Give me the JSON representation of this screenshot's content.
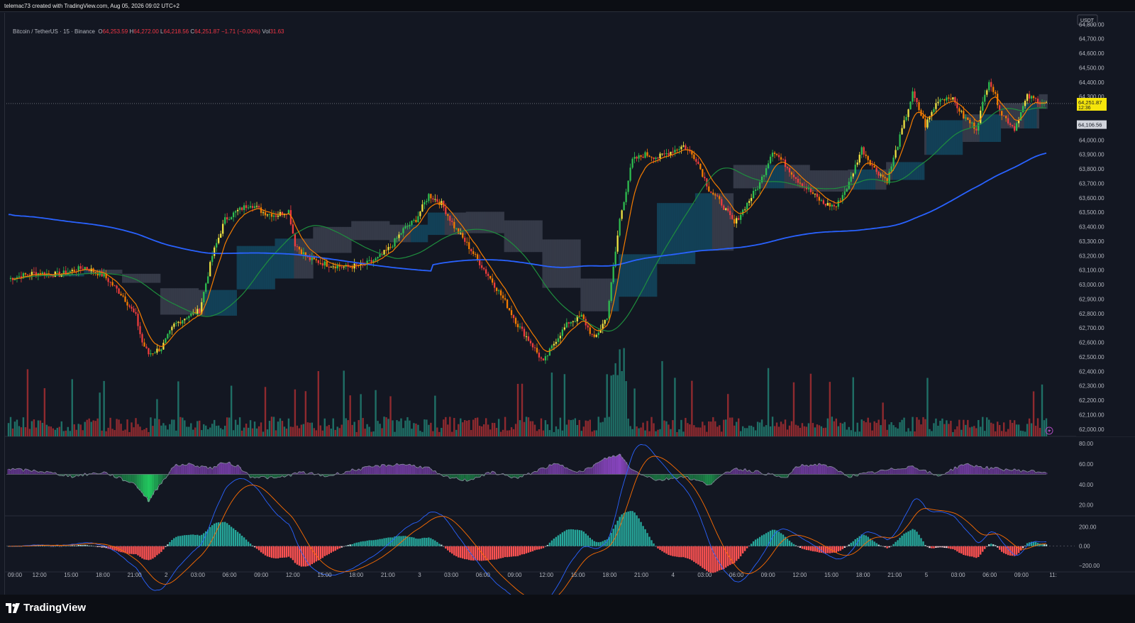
{
  "header": {
    "credit": "telemac73 created with TradingView.com, Aug 05, 2026 09:02 UTC+2"
  },
  "legend": {
    "symbol": "Bitcoin / TetherUS · 15 · Binance",
    "open_label": "O",
    "open": "64,253.59",
    "high_label": "H",
    "high": "64,272.00",
    "low_label": "L",
    "low": "64,218.56",
    "close_label": "C",
    "close": "64,251.87",
    "change": "−1.71 (−0.00%)",
    "vol_label": "Vol",
    "vol": "31.63"
  },
  "footer": {
    "brand": "TradingView"
  },
  "colors": {
    "background": "#131722",
    "grid": "#2a2e39",
    "up": "#2ebd4f",
    "down": "#ef3d3d",
    "vol_up": "#1f6f66",
    "vol_down": "#8f2a2f",
    "ma_blue": "#2962ff",
    "ma_green": "#1e8e3e",
    "ema_orange": "#f57c00",
    "cloud_teal": "#13475e",
    "cloud_grey": "#3b3f4d",
    "rsi_purple": "#9b4dd8",
    "rsi_green": "#22c55e",
    "price_tag": "#f5e50b"
  },
  "chart_data": [
    {
      "type": "candlestick",
      "name": "price",
      "currency_label": "USDT",
      "last_price": "64,251.87",
      "countdown": "12:36",
      "second_tag": "64,106.56",
      "ylim": [
        61950,
        64880
      ],
      "y_ticks": [
        "64,800.00",
        "64,700.00",
        "64,600.00",
        "64,500.00",
        "64,400.00",
        "64,300.00",
        "64,000.00",
        "63,900.00",
        "63,800.00",
        "63,700.00",
        "63,600.00",
        "63,500.00",
        "63,400.00",
        "63,300.00",
        "63,200.00",
        "63,100.00",
        "63,000.00",
        "62,900.00",
        "62,800.00",
        "62,700.00",
        "62,600.00",
        "62,500.00",
        "62,400.00",
        "62,300.00",
        "62,200.00",
        "62,100.00",
        "62,000.00"
      ],
      "x_ticks": [
        "09:00",
        "12:00",
        "15:00",
        "18:00",
        "21:00",
        "2",
        "03:00",
        "06:00",
        "09:00",
        "12:00",
        "15:00",
        "18:00",
        "21:00",
        "3",
        "03:00",
        "06:00",
        "09:00",
        "12:00",
        "15:00",
        "18:00",
        "21:00",
        "4",
        "03:00",
        "06:00",
        "09:00",
        "12:00",
        "15:00",
        "18:00",
        "21:00",
        "5",
        "03:00",
        "06:00",
        "09:00",
        "11:"
      ],
      "close_path": [
        [
          0,
          63040
        ],
        [
          12,
          63080
        ],
        [
          24,
          63070
        ],
        [
          36,
          63120
        ],
        [
          45,
          63060
        ],
        [
          54,
          62920
        ],
        [
          60,
          62780
        ],
        [
          63,
          62600
        ],
        [
          66,
          62520
        ],
        [
          72,
          62560
        ],
        [
          78,
          62720
        ],
        [
          84,
          62780
        ],
        [
          90,
          62820
        ],
        [
          96,
          63200
        ],
        [
          102,
          63450
        ],
        [
          108,
          63510
        ],
        [
          114,
          63560
        ],
        [
          120,
          63500
        ],
        [
          126,
          63480
        ],
        [
          132,
          63510
        ],
        [
          135,
          63280
        ],
        [
          141,
          63180
        ],
        [
          150,
          63140
        ],
        [
          159,
          63120
        ],
        [
          168,
          63140
        ],
        [
          174,
          63180
        ],
        [
          180,
          63260
        ],
        [
          186,
          63380
        ],
        [
          192,
          63450
        ],
        [
          198,
          63620
        ],
        [
          204,
          63560
        ],
        [
          210,
          63400
        ],
        [
          216,
          63280
        ],
        [
          222,
          63150
        ],
        [
          228,
          63020
        ],
        [
          234,
          62880
        ],
        [
          240,
          62720
        ],
        [
          246,
          62600
        ],
        [
          252,
          62460
        ],
        [
          258,
          62620
        ],
        [
          264,
          62740
        ],
        [
          270,
          62780
        ],
        [
          276,
          62620
        ],
        [
          282,
          62780
        ],
        [
          288,
          63450
        ],
        [
          294,
          63860
        ],
        [
          300,
          63900
        ],
        [
          306,
          63880
        ],
        [
          312,
          63920
        ],
        [
          318,
          63960
        ],
        [
          324,
          63870
        ],
        [
          330,
          63660
        ],
        [
          336,
          63560
        ],
        [
          342,
          63420
        ],
        [
          348,
          63560
        ],
        [
          354,
          63700
        ],
        [
          360,
          63930
        ],
        [
          366,
          63830
        ],
        [
          372,
          63720
        ],
        [
          378,
          63640
        ],
        [
          384,
          63560
        ],
        [
          390,
          63540
        ],
        [
          396,
          63700
        ],
        [
          402,
          63940
        ],
        [
          408,
          63800
        ],
        [
          414,
          63720
        ],
        [
          420,
          64020
        ],
        [
          426,
          64320
        ],
        [
          432,
          64100
        ],
        [
          438,
          64280
        ],
        [
          444,
          64300
        ],
        [
          450,
          64160
        ],
        [
          456,
          64080
        ],
        [
          462,
          64420
        ],
        [
          468,
          64180
        ],
        [
          474,
          64080
        ],
        [
          480,
          64300
        ],
        [
          489,
          64250
        ]
      ],
      "overlays": [
        "SMA blue",
        "SMA green",
        "EMA orange",
        "Cloud band"
      ]
    },
    {
      "type": "bar",
      "name": "volume",
      "values_description": "per-candle volume bars, colored by candle direction"
    },
    {
      "type": "area",
      "name": "RSI",
      "ylim": [
        10,
        85
      ],
      "y_ticks": [
        "80.00",
        "60.00",
        "40.00",
        "20.00"
      ],
      "midline": 50,
      "points": [
        [
          0,
          55
        ],
        [
          15,
          53
        ],
        [
          30,
          48
        ],
        [
          45,
          52
        ],
        [
          60,
          40
        ],
        [
          66,
          24
        ],
        [
          72,
          42
        ],
        [
          78,
          58
        ],
        [
          84,
          60
        ],
        [
          96,
          56
        ],
        [
          102,
          62
        ],
        [
          108,
          58
        ],
        [
          114,
          48
        ],
        [
          126,
          46
        ],
        [
          138,
          52
        ],
        [
          150,
          48
        ],
        [
          162,
          54
        ],
        [
          174,
          58
        ],
        [
          186,
          60
        ],
        [
          198,
          56
        ],
        [
          204,
          48
        ],
        [
          216,
          44
        ],
        [
          228,
          52
        ],
        [
          240,
          46
        ],
        [
          252,
          56
        ],
        [
          258,
          60
        ],
        [
          270,
          52
        ],
        [
          282,
          66
        ],
        [
          288,
          69
        ],
        [
          294,
          54
        ],
        [
          306,
          44
        ],
        [
          318,
          48
        ],
        [
          330,
          40
        ],
        [
          342,
          56
        ],
        [
          354,
          52
        ],
        [
          366,
          46
        ],
        [
          372,
          58
        ],
        [
          384,
          60
        ],
        [
          396,
          48
        ],
        [
          414,
          54
        ],
        [
          426,
          58
        ],
        [
          438,
          48
        ],
        [
          450,
          60
        ],
        [
          462,
          56
        ],
        [
          474,
          54
        ],
        [
          489,
          52
        ]
      ]
    },
    {
      "type": "bar",
      "name": "MACD",
      "ylim": [
        -260,
        300
      ],
      "y_ticks": [
        "200.00",
        "0.00",
        "−200.00"
      ]
    }
  ]
}
